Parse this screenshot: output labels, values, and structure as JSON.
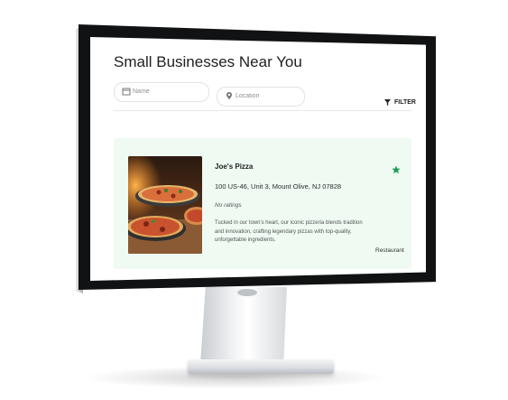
{
  "page": {
    "title": "Small Businesses Near You"
  },
  "search": {
    "name_placeholder": "Name",
    "location_placeholder": "Location",
    "filter_label": "FILTER"
  },
  "listing": {
    "name": "Joe's Pizza",
    "address": "100 US-46, Unit 3, Mount Olive, NJ 07828",
    "rating": "No ratings",
    "description": "Tucked in our town's heart, our iconic pizzeria blends tradition and innovation, crafting legendary pizzas with top-quality, unforgettable ingredients.",
    "category": "Restaurant",
    "favorited": true
  },
  "colors": {
    "card_background": "#eefaf2",
    "star": "#1f9d55",
    "bezel": "#111213"
  },
  "icons": {
    "name_field": "storefront-icon",
    "location_field": "map-pin-icon",
    "filter": "funnel-icon",
    "favorite": "star-icon"
  }
}
